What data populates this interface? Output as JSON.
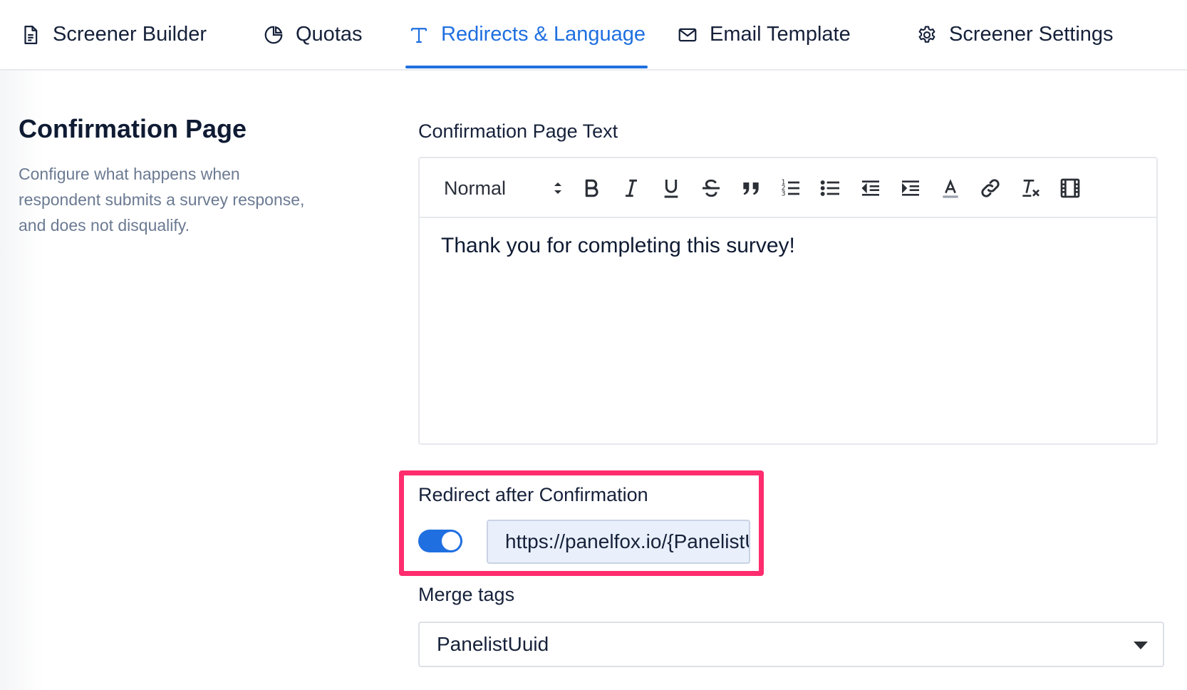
{
  "tabs": [
    {
      "label": "Screener Builder",
      "icon": "document-icon"
    },
    {
      "label": "Quotas",
      "icon": "pie-chart-icon"
    },
    {
      "label": "Redirects & Language",
      "icon": "text-icon",
      "active": true
    },
    {
      "label": "Email Template",
      "icon": "mail-icon"
    },
    {
      "label": "Screener Settings",
      "icon": "gear-icon"
    }
  ],
  "section": {
    "title": "Confirmation Page",
    "description": "Configure what happens when respondent submits a survey response, and does not disqualify."
  },
  "editor": {
    "label": "Confirmation Page Text",
    "format_value": "Normal",
    "content": "Thank you for completing this survey!"
  },
  "redirect": {
    "label": "Redirect after Confirmation",
    "enabled": true,
    "url_value": "https://panelfox.io/{PanelistUuid}"
  },
  "merge_tags": {
    "label": "Merge tags",
    "selected": "PanelistUuid"
  },
  "colors": {
    "accent": "#1f6fe0",
    "highlight": "#ff2d6e"
  }
}
